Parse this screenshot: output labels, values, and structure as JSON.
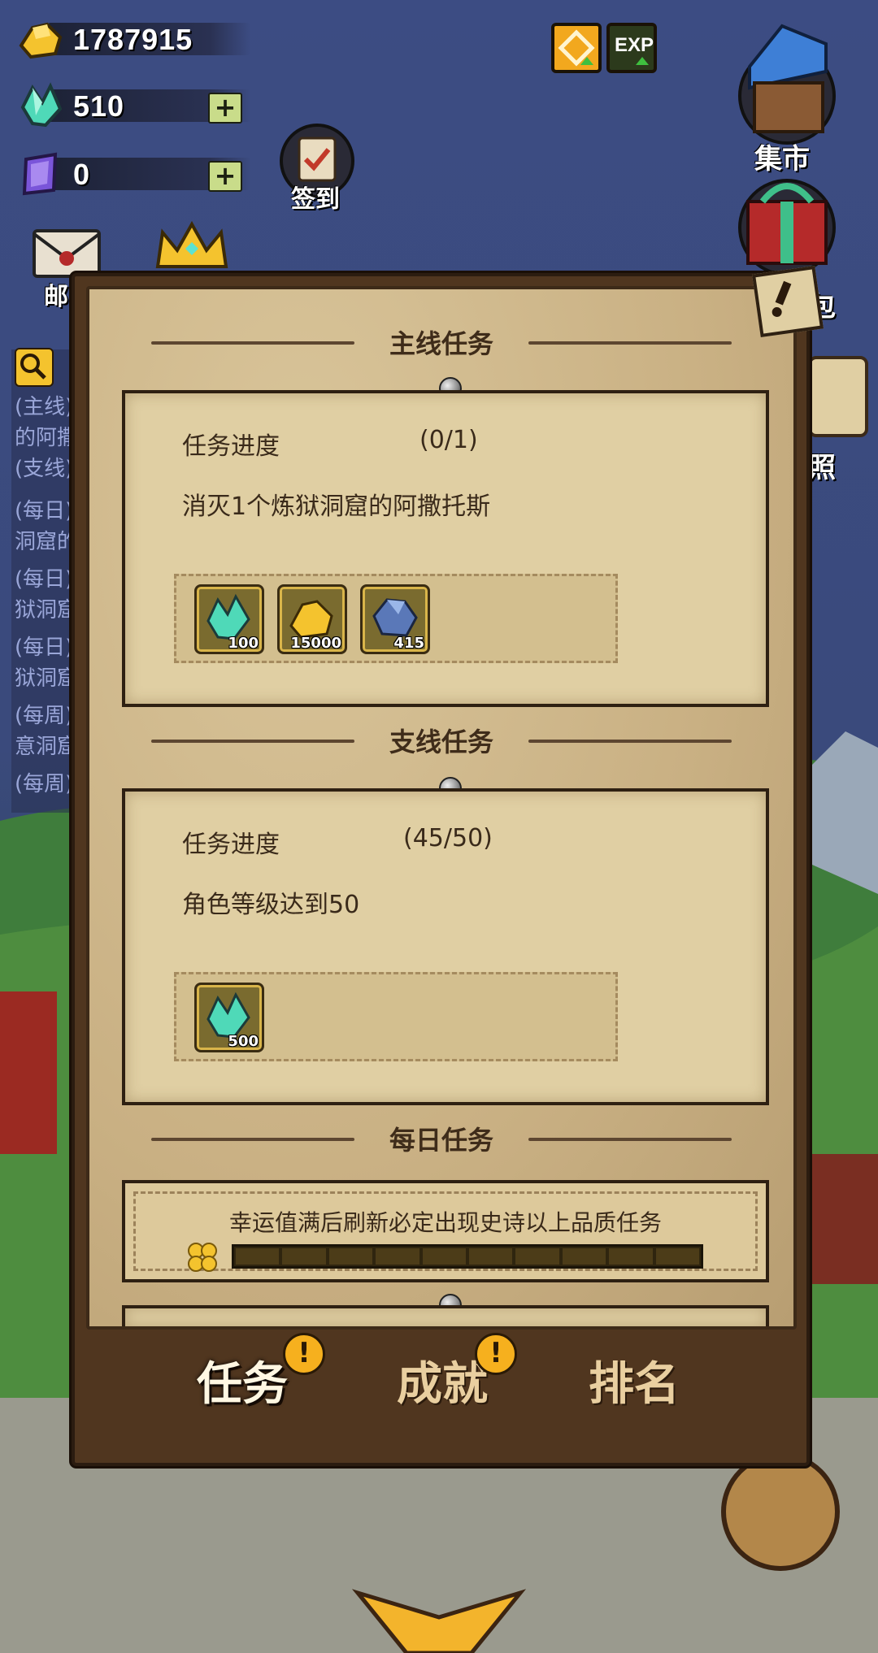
{
  "currencies": {
    "gold": "1787915",
    "diamond": "510",
    "crystal": "0"
  },
  "top_buttons": {
    "checkin_label": "签到",
    "mail_label_partial": "邮",
    "market_label": "集市",
    "gift_label_partial": "包",
    "photo_label_partial": "照",
    "exp_label": "EXP"
  },
  "left_list": [
    "(主线)",
    "的阿撒",
    "(支线)",
    "(每日)",
    "洞窟的",
    "(每日)",
    "狱洞窟",
    "(每日)",
    "狱洞窟",
    "(每周)",
    "意洞窟",
    "(每周)"
  ],
  "sections": {
    "main": {
      "title": "主线任务",
      "progress_label": "任务进度",
      "progress_value": "(0/1)",
      "description": "消灭1个炼狱洞窟的阿撒托斯",
      "rewards": [
        {
          "icon": "diamond-icon",
          "qty": "100"
        },
        {
          "icon": "gold-icon",
          "qty": "15000"
        },
        {
          "icon": "ore-icon",
          "qty": "415"
        }
      ]
    },
    "side": {
      "title": "支线任务",
      "progress_label": "任务进度",
      "progress_value": "(45/50)",
      "description": "角色等级达到50",
      "rewards": [
        {
          "icon": "diamond-icon",
          "qty": "500"
        }
      ]
    },
    "daily": {
      "title": "每日任务",
      "luck_text": "幸运值满后刷新必定出现史诗以上品质任务",
      "luck_progress": 0
    }
  },
  "tabs": [
    {
      "label": "任务",
      "active": true,
      "alert": "!"
    },
    {
      "label": "成就",
      "active": false,
      "alert": "!"
    },
    {
      "label": "排名",
      "active": false
    }
  ],
  "colors": {
    "parchment": "#cdb689",
    "frame": "#50361f",
    "alert": "#f6b01e"
  }
}
